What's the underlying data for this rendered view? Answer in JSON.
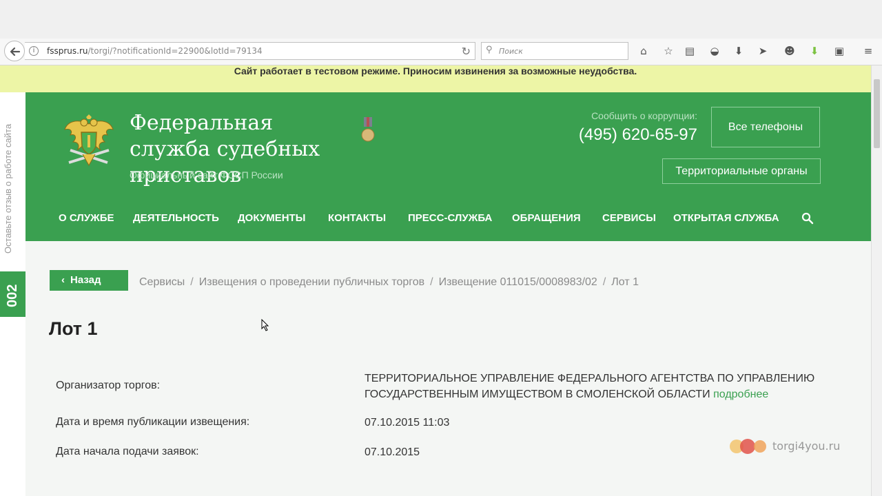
{
  "browser": {
    "url_host": "fssprus.ru",
    "url_path": "/torgi/?notificationId=22900&lotId=79134",
    "search_placeholder": "Поиск"
  },
  "notice": "Сайт работает в тестовом режиме. Приносим извинения за возможные неудобства.",
  "feedback": {
    "label": "Оставьте отзыв о работе сайта",
    "number": "002"
  },
  "header": {
    "title": "Федеральная служба судебных приставов",
    "subtitle": "Официальный сайт ФССП России",
    "corruption_label": "Сообщить о коррупции:",
    "corruption_phone": "(495) 620-65-97",
    "all_phones_button": "Все телефоны",
    "territorial_button": "Территориальные органы"
  },
  "nav": {
    "items": [
      "О СЛУЖБЕ",
      "ДЕЯТЕЛЬНОСТЬ",
      "ДОКУМЕНТЫ",
      "КОНТАКТЫ",
      "ПРЕСС-СЛУЖБА",
      "ОБРАЩЕНИЯ",
      "СЕРВИСЫ",
      "ОТКРЫТАЯ СЛУЖБА"
    ]
  },
  "content": {
    "back_button": "Назад",
    "breadcrumbs": [
      "Сервисы",
      "Извещения о проведении публичных торгов",
      "Извещение 011015/0008983/02",
      "Лот 1"
    ],
    "title": "Лот 1",
    "rows": [
      {
        "label": "Организатор торгов:",
        "value": "ТЕРРИТОРИАЛЬНОЕ УПРАВЛЕНИЕ ФЕДЕРАЛЬНОГО АГЕНТСТВА ПО УПРАВЛЕНИЮ ГОСУДАРСТВЕННЫМ ИМУЩЕСТВОМ В СМОЛЕНСКОЙ ОБЛАСТИ",
        "link": "подробнее"
      },
      {
        "label": "Дата и время публикации извещения:",
        "value": "07.10.2015 11:03"
      },
      {
        "label": "Дата начала подачи заявок:",
        "value": "07.10.2015"
      }
    ]
  },
  "watermark": "torgi4you.ru",
  "colors": {
    "brand_green": "#3aa050",
    "notice_bg": "#edf5a6",
    "content_bg": "#f4f6f4"
  }
}
